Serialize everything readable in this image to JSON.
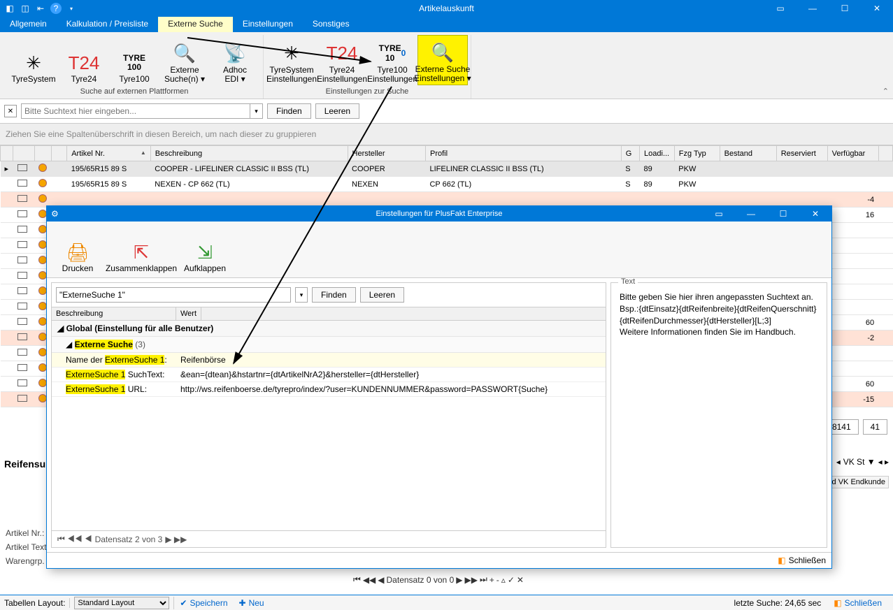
{
  "window": {
    "title": "Artikelauskunft"
  },
  "tabs": {
    "t0": "Allgemein",
    "t1": "Kalkulation / Preisliste",
    "t2": "Externe Suche",
    "t3": "Einstellungen",
    "t4": "Sonstiges"
  },
  "ribbon": {
    "g1": "Suche auf externen Plattformen",
    "g2": "Einstellungen zur Suche",
    "i0": "TyreSystem",
    "i1": "Tyre24",
    "i2": "Tyre100",
    "i3": "Externe\nSuche(n) ▾",
    "i4": "Adhoc\nEDI ▾",
    "i5": "TyreSystem\nEinstellungen",
    "i6": "Tyre24\nEinstellungen",
    "i7": "Tyre100\nEinstellungen",
    "i8": "Externe Suche\nEinstellungen ▾"
  },
  "search": {
    "placeholder": "Bitte Suchtext hier eingeben...",
    "find": "Finden",
    "clear": "Leeren"
  },
  "groupby": "Ziehen Sie eine Spaltenüberschrift in diesen Bereich, um nach dieser zu gruppieren",
  "cols": {
    "art": "Artikel Nr.",
    "besch": "Beschreibung",
    "her": "Hersteller",
    "prof": "Profil",
    "g": "G",
    "load": "Loadi...",
    "fzg": "Fzg Typ",
    "best": "Bestand",
    "res": "Reserviert",
    "verf": "Verfügbar"
  },
  "rows": [
    {
      "art": "195/65R15 89 S",
      "besch": "COOPER - LIFELINER CLASSIC II BSS (TL)",
      "her": "COOPER",
      "prof": "LIFELINER CLASSIC II BSS (TL)",
      "g": "S",
      "load": "89",
      "fzg": "PKW",
      "verf": ""
    },
    {
      "art": "195/65R15 89 S",
      "besch": "NEXEN - CP 662 (TL)",
      "her": "NEXEN",
      "prof": "CP 662 (TL)",
      "g": "S",
      "load": "89",
      "fzg": "PKW",
      "verf": ""
    },
    {
      "verf": "-4"
    },
    {
      "verf": "16"
    },
    {
      "verf": ""
    },
    {
      "verf": ""
    },
    {
      "verf": ""
    },
    {
      "verf": ""
    },
    {
      "verf": ""
    },
    {
      "verf": ""
    },
    {
      "verf": "60"
    },
    {
      "verf": "-2"
    },
    {
      "verf": ""
    },
    {
      "verf": ""
    },
    {
      "verf": "60"
    },
    {
      "verf": "-15"
    }
  ],
  "totals": {
    "a": "18141",
    "b": "41"
  },
  "dialog": {
    "title": "Einstellungen für PlusFakt Enterprise",
    "rb": {
      "print": "Drucken",
      "collapse": "Zusammenklappen",
      "expand": "Aufklappen"
    },
    "filter": "\"ExterneSuche 1\"",
    "cols": {
      "k": "Beschreibung",
      "v": "Wert"
    },
    "grp": "Global (Einstellung für alle Benutzer)",
    "sub_a": "Externe Suche",
    "sub_cnt": "(3)",
    "p1k_a": "Name der ",
    "p1k_b": "ExterneSuche 1",
    "p1k_c": ":",
    "p1v": "Reifenbörse",
    "p2k_a": "ExterneSuche 1",
    "p2k_b": " SuchText:",
    "p2v": "&ean={dtean}&hstartnr={dtArtikelNrA2}&hersteller={dtHersteller}",
    "p3k_a": "ExterneSuche 1",
    "p3k_b": " URL:",
    "p3v": "http://ws.reifenboerse.de/tyrepro/index/?user=KUNDENNUMMER&password=PASSWORT{Suche}",
    "help": "Bitte geben Sie hier ihren angepassten Suchtext an.\nBsp.:{dtEinsatz}{dtReifenbreite}{dtReifenQuerschnitt}{dtReifenDurchmesser}{dtHersteller}[L;3]\nWeitere Informationen finden Sie im Handbuch.",
    "helpLegend": "Text",
    "status": "Datensatz 2 von 3",
    "close": "Schließen"
  },
  "nav": "Datensatz 0 von 0",
  "labels": {
    "l1": "Artikel Nr.:",
    "l2": "Artikel Text",
    "l3": "Warengrp."
  },
  "reif": "Reifensu",
  "colstub": "VK St ▼",
  "colstub2": "nd VK Endkunde",
  "foot": {
    "lay": "Tabellen Layout:",
    "layv": "Standard Layout",
    "save": "Speichern",
    "new": "Neu",
    "time": "letzte Suche: 24,65 sec",
    "close": "Schließen"
  }
}
